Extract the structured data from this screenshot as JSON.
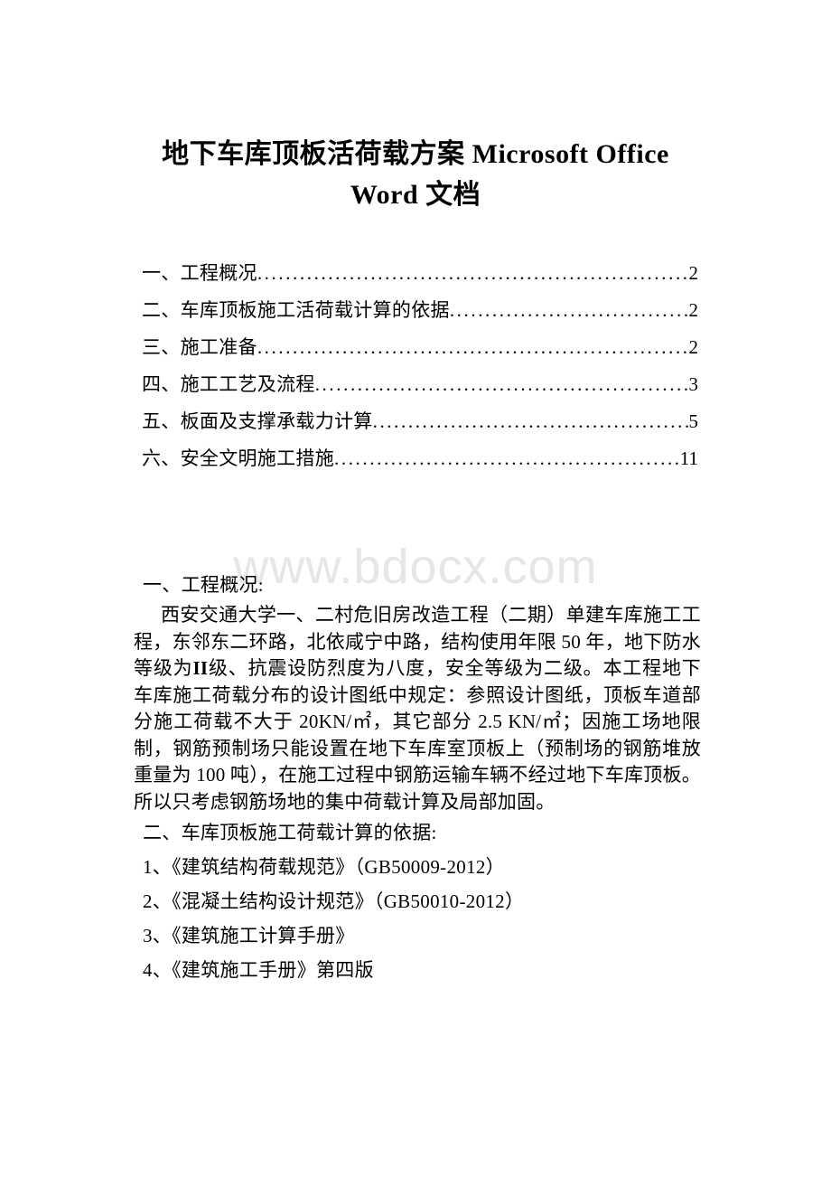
{
  "document": {
    "title_line1": "地下车库顶板活荷载方案 Microsoft Office",
    "title_line2": "Word 文档",
    "watermark": "www.bdocx.com",
    "background_color": "#ffffff",
    "text_color": "#000000",
    "watermark_color": "#e6e6e6"
  },
  "toc": {
    "entries": [
      {
        "label": "一、工程概况",
        "page": "2"
      },
      {
        "label": "二、车库顶板施工活荷载计算的依据",
        "page": "2"
      },
      {
        "label": "三、施工准备",
        "page": "2"
      },
      {
        "label": "四、施工工艺及流程",
        "page": "3"
      },
      {
        "label": "五、板面及支撑承载力计算",
        "page": "5"
      },
      {
        "label": "六、安全文明施工措施",
        "page": "11"
      }
    ]
  },
  "sections": {
    "section_one": {
      "heading": "一、工程概况:",
      "paragraph_part1": "西安交通大学一、二村危旧房改造工程（二期）单建车库施工工程，东邻东二环路，北依咸宁中路，结构使用年限 50 年，地下防水等级为",
      "paragraph_grade": "II",
      "paragraph_part2": "级、抗震设防烈度为八度，安全等级为二级。本工程地下车库施工荷载分布的设计图纸中规定：参照设计图纸，顶板车道部分施工荷载不大于 20KN/㎡，其它部分 2.5 KN/㎡；因施工场地限制，钢筋预制场只能设置在地下车库室顶板上（预制场的钢筋堆放重量为 100 吨），在施工过程中钢筋运输车辆不经过地下车库顶板。所以只考虑钢筋场地的集中荷载计算及局部加固。"
    },
    "section_two": {
      "heading": "二、车库顶板施工荷载计算的依据:",
      "references": [
        "1、《建筑结构荷载规范》（GB50009-2012）",
        "2、《混凝土结构设计规范》（GB50010-2012）",
        "3、《建筑施工计算手册》",
        "4、《建筑施工手册》第四版"
      ]
    }
  }
}
